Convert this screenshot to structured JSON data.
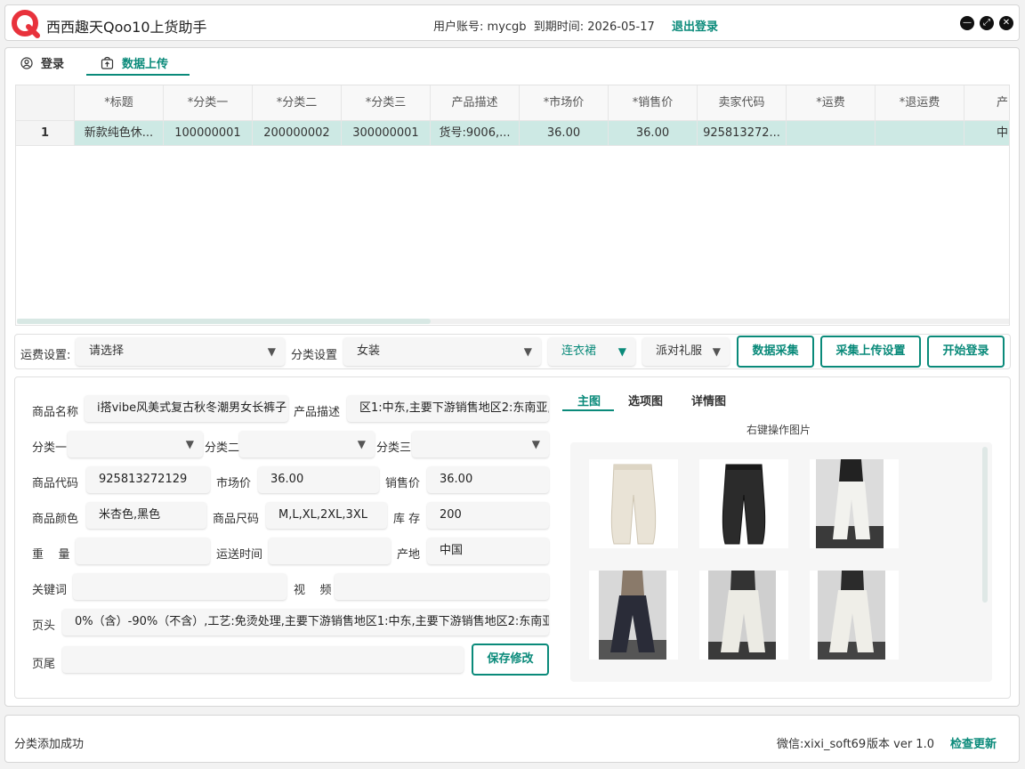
{
  "header": {
    "title": "西西趣天Qoo10上货助手",
    "account_label": "用户账号:",
    "account": "mycgb",
    "expire_label": "到期时间:",
    "expire": "2026-05-17",
    "logout": "退出登录"
  },
  "tabs": [
    {
      "label": "登录",
      "icon": "user-circle-icon"
    },
    {
      "label": "数据上传",
      "icon": "upload-bag-icon"
    }
  ],
  "grid": {
    "columns": [
      "",
      "*标题",
      "*分类一",
      "*分类二",
      "*分类三",
      "产品描述",
      "*市场价",
      "*销售价",
      "卖家代码",
      "*运费",
      "*退运费",
      "产"
    ],
    "rows": [
      [
        "1",
        "新款纯色休...",
        "100000001",
        "200000002",
        "300000001",
        "货号:9006,...",
        "36.00",
        "36.00",
        "925813272...",
        "",
        "",
        "中"
      ]
    ]
  },
  "settings": {
    "shipping_label": "运费设置:",
    "shipping_value": "请选择",
    "category_label": "分类设置",
    "cat1": "女装",
    "cat2": "连衣裙",
    "cat3": "派对礼服",
    "btn_collect": "数据采集",
    "btn_upload_settings": "采集上传设置",
    "btn_start_login": "开始登录"
  },
  "form": {
    "name_label": "商品名称",
    "name_value": "i搭vibe风美式复古秋冬潮男女长裤子",
    "desc_label": "产品描述",
    "desc_value": "区1:中东,主要下游销售地区2:东南亚,",
    "cat1_label": "分类一",
    "cat2_label": "分类二",
    "cat3_label": "分类三",
    "code_label": "商品代码",
    "code_value": "925813272129",
    "market_label": "市场价",
    "market_value": "36.00",
    "sale_label": "销售价",
    "sale_value": "36.00",
    "color_label": "商品颜色",
    "color_value": "米杏色,黑色",
    "size_label": "商品尺码",
    "size_value": "M,L,XL,2XL,3XL",
    "stock_label": "库 存",
    "stock_value": "200",
    "weight_label": "重    量",
    "ship_time_label": "运送时间",
    "origin_label": "产地",
    "origin_value": "中国",
    "keyword_label": "关键词",
    "video_label": "视    频",
    "header_label": "页头",
    "header_value": "0%（含）-90%（不含）,工艺:免烫处理,主要下游销售地区1:中东,主要下游销售地区2:东南亚,",
    "footer_label": "页尾",
    "save": "保存修改"
  },
  "images": {
    "tabs": [
      "主图",
      "选项图",
      "详情图"
    ],
    "hint": "右键操作图片"
  },
  "status": {
    "message": "分类添加成功",
    "wechat": "微信:xixi_soft69",
    "version": "版本 ver 1.0",
    "check_update": "检查更新"
  },
  "colors": {
    "accent": "#0a8a7a",
    "row_selected": "#cde9e4",
    "logo": "#e8323c"
  }
}
